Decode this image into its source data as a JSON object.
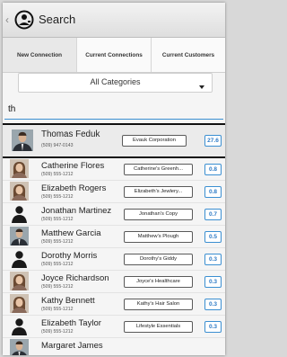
{
  "header": {
    "back_icon": "chevron-left-icon",
    "logo_icon": "app-logo-icon",
    "title": "Search"
  },
  "tabs": [
    {
      "label": "New Connection",
      "active": true
    },
    {
      "label": "Current Connections",
      "active": false
    },
    {
      "label": "Current Customers",
      "active": false
    }
  ],
  "category": {
    "selected": "All Categories"
  },
  "search": {
    "value": "th"
  },
  "accent_color": "#3b8fd1",
  "contacts": [
    {
      "name": "Thomas Feduk",
      "phone": "(509) 947-0143",
      "company": "Evauk Corporation",
      "score": "27.6",
      "selected": true
    },
    {
      "name": "Catherine Flores",
      "phone": "(509) 555-1212",
      "company": "Catherine's Greenh...",
      "score": "0.8",
      "selected": false
    },
    {
      "name": "Elizabeth Rogers",
      "phone": "(509) 555-1212",
      "company": "Elizabeth's Jewlery...",
      "score": "0.8",
      "selected": false
    },
    {
      "name": "Jonathan Martinez",
      "phone": "(509) 555-1212",
      "company": "Jonathan's Copy",
      "score": "0.7",
      "selected": false
    },
    {
      "name": "Matthew Garcia",
      "phone": "(509) 555-1212",
      "company": "Matthew's Plough",
      "score": "0.5",
      "selected": false
    },
    {
      "name": "Dorothy Morris",
      "phone": "(509) 555-1212",
      "company": "Dorothy's Giddy",
      "score": "0.3",
      "selected": false
    },
    {
      "name": "Joyce Richardson",
      "phone": "(509) 555-1212",
      "company": "Joyce's Healthcare",
      "score": "0.3",
      "selected": false
    },
    {
      "name": "Kathy Bennett",
      "phone": "(509) 555-1212",
      "company": "Kathy's Hair Salon",
      "score": "0.3",
      "selected": false
    },
    {
      "name": "Elizabeth Taylor",
      "phone": "(509) 555-1212",
      "company": "Lifestyle Essentials",
      "score": "0.3",
      "selected": false
    },
    {
      "name": "Margaret James",
      "phone": "",
      "company": "",
      "score": "",
      "selected": false
    }
  ]
}
